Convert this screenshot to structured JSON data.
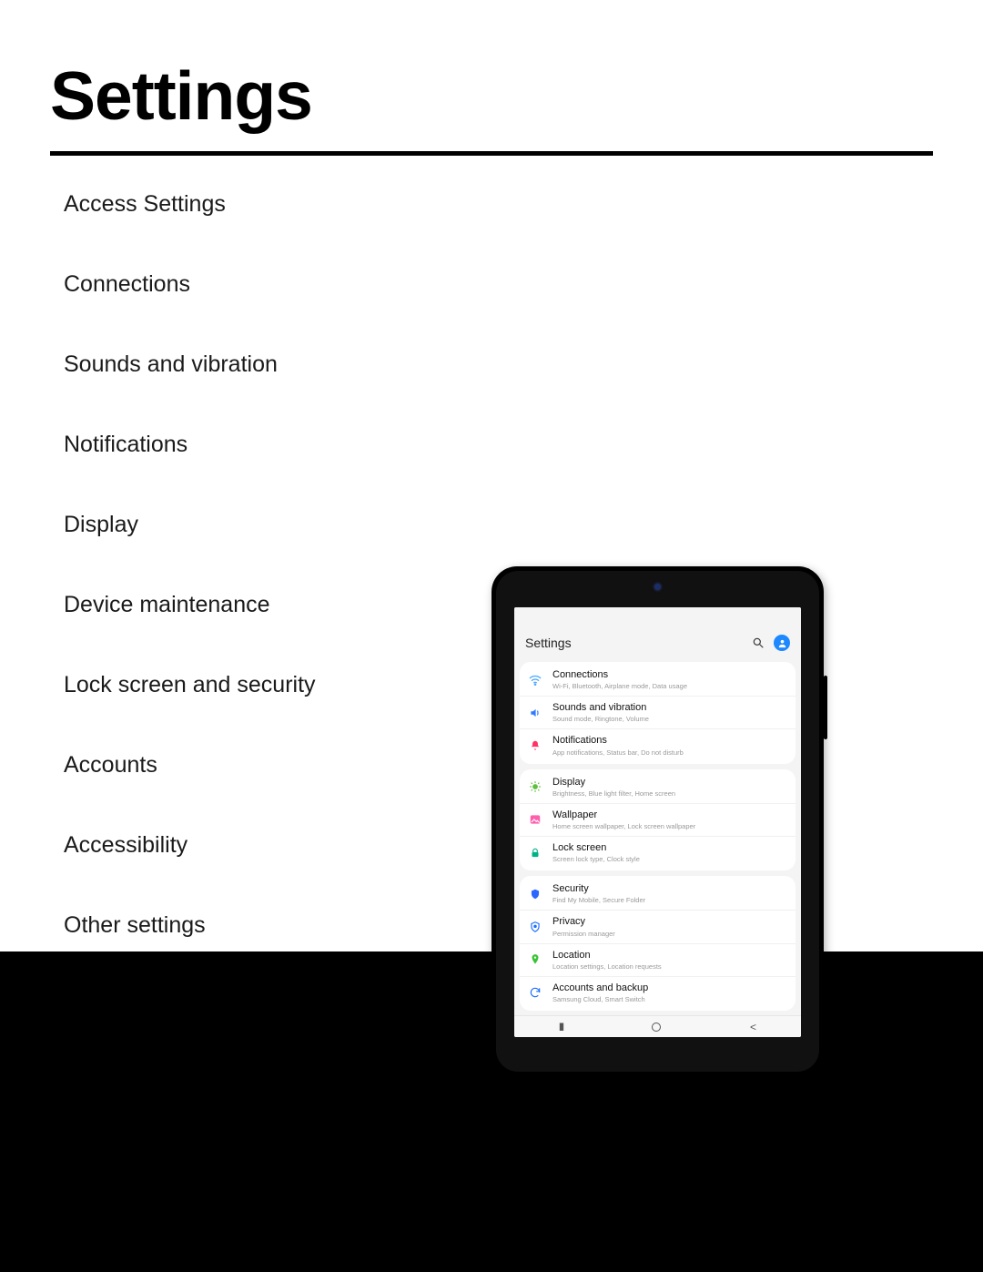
{
  "page_title": "Settings",
  "toc": [
    "Access Settings",
    "Connections",
    "Sounds and vibration",
    "Notifications",
    "Display",
    "Device maintenance",
    "Lock screen and security",
    "Accounts",
    "Accessibility",
    "Other settings"
  ],
  "tablet": {
    "header": "Settings",
    "rows": {
      "connections": {
        "title": "Connections",
        "sub": "Wi-Fi, Bluetooth, Airplane mode, Data usage"
      },
      "sounds": {
        "title": "Sounds and vibration",
        "sub": "Sound mode, Ringtone, Volume"
      },
      "notifications": {
        "title": "Notifications",
        "sub": "App notifications, Status bar, Do not disturb"
      },
      "display": {
        "title": "Display",
        "sub": "Brightness, Blue light filter, Home screen"
      },
      "wallpaper": {
        "title": "Wallpaper",
        "sub": "Home screen wallpaper, Lock screen wallpaper"
      },
      "lockscreen": {
        "title": "Lock screen",
        "sub": "Screen lock type, Clock style"
      },
      "security": {
        "title": "Security",
        "sub": "Find My Mobile, Secure Folder"
      },
      "privacy": {
        "title": "Privacy",
        "sub": "Permission manager"
      },
      "location": {
        "title": "Location",
        "sub": "Location settings, Location requests"
      },
      "accounts": {
        "title": "Accounts and backup",
        "sub": "Samsung Cloud, Smart Switch"
      }
    }
  }
}
